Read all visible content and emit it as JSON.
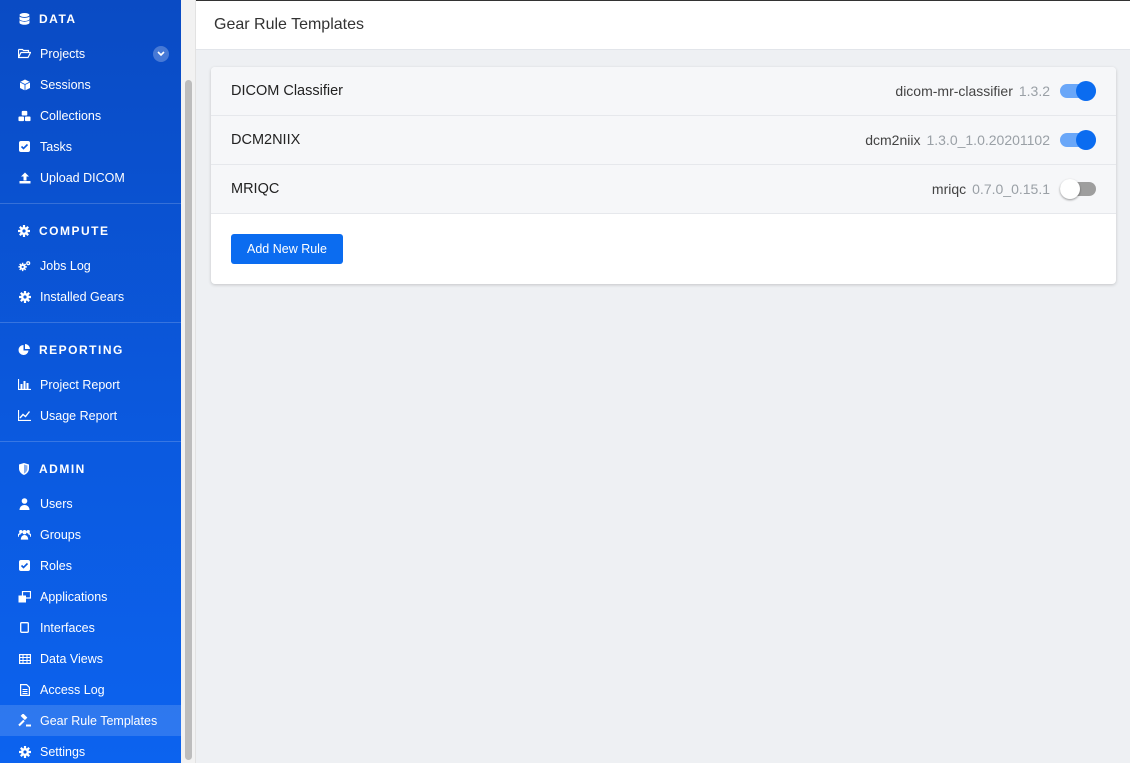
{
  "sidebar": {
    "sections": [
      {
        "title": "DATA",
        "icon": "database-icon",
        "items": [
          {
            "label": "Projects",
            "icon": "folder-open-icon",
            "expandable": true
          },
          {
            "label": "Sessions",
            "icon": "cube-icon"
          },
          {
            "label": "Collections",
            "icon": "cubes-icon"
          },
          {
            "label": "Tasks",
            "icon": "check-square-icon"
          },
          {
            "label": "Upload DICOM",
            "icon": "upload-icon"
          }
        ]
      },
      {
        "title": "COMPUTE",
        "icon": "cog-icon",
        "items": [
          {
            "label": "Jobs Log",
            "icon": "cogs-icon"
          },
          {
            "label": "Installed Gears",
            "icon": "cog-icon"
          }
        ]
      },
      {
        "title": "REPORTING",
        "icon": "pie-chart-icon",
        "items": [
          {
            "label": "Project Report",
            "icon": "bar-chart-icon"
          },
          {
            "label": "Usage Report",
            "icon": "line-chart-icon"
          }
        ]
      },
      {
        "title": "ADMIN",
        "icon": "shield-icon",
        "items": [
          {
            "label": "Users",
            "icon": "user-icon"
          },
          {
            "label": "Groups",
            "icon": "users-icon"
          },
          {
            "label": "Roles",
            "icon": "check-square-icon"
          },
          {
            "label": "Applications",
            "icon": "window-restore-icon"
          },
          {
            "label": "Interfaces",
            "icon": "tablet-icon"
          },
          {
            "label": "Data Views",
            "icon": "table-icon"
          },
          {
            "label": "Access Log",
            "icon": "file-text-icon"
          },
          {
            "label": "Gear Rule Templates",
            "icon": "gavel-icon",
            "active": true
          },
          {
            "label": "Settings",
            "icon": "cog-icon"
          }
        ]
      }
    ]
  },
  "header": {
    "title": "Gear Rule Templates"
  },
  "rules": [
    {
      "name": "DICOM Classifier",
      "gear": "dicom-mr-classifier",
      "version": "1.3.2",
      "enabled": true
    },
    {
      "name": "DCM2NIIX",
      "gear": "dcm2niix",
      "version": "1.3.0_1.0.20201102",
      "enabled": true
    },
    {
      "name": "MRIQC",
      "gear": "mriqc",
      "version": "0.7.0_0.15.1",
      "enabled": false
    }
  ],
  "add_button_label": "Add New Rule",
  "colors": {
    "sidebar": "#0b5ae0",
    "accent": "#0b6cf0",
    "background": "#eef0f3"
  }
}
